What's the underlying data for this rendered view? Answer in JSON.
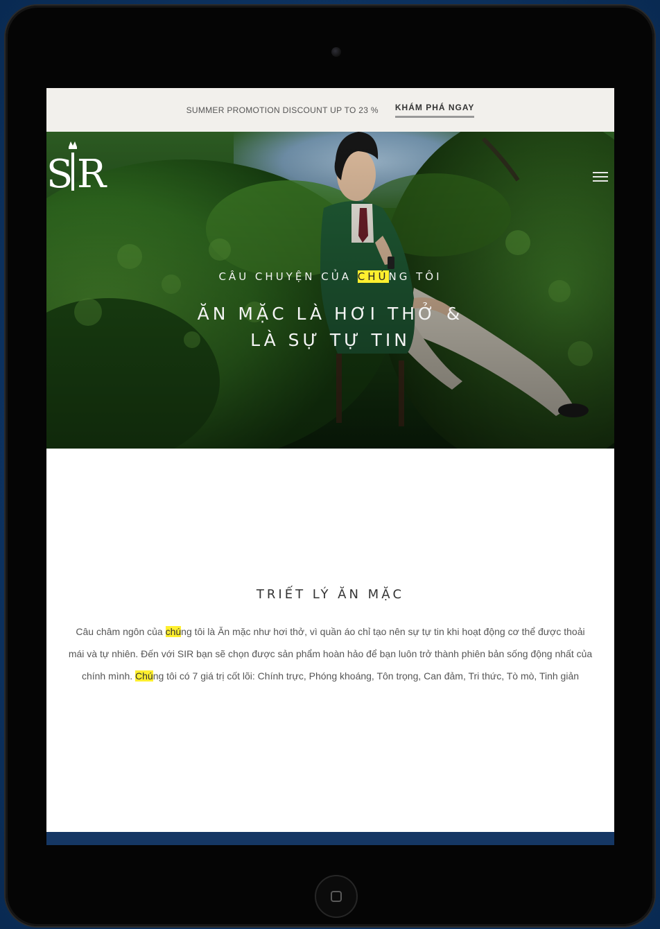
{
  "promo": {
    "text": "SUMMER PROMOTION DISCOUNT UP TO 23 %",
    "link": "KHÁM PHÁ NGAY"
  },
  "brand": {
    "logo_text": "SIR"
  },
  "hero": {
    "kicker_pre": "CÂU CHUYỆN CỦA ",
    "kicker_highlight": "CHÚ",
    "kicker_post": "NG TÔI",
    "title_line1": "ĂN MẶC LÀ HƠI THỞ &",
    "title_line2": "LÀ SỰ TỰ TIN"
  },
  "philosophy": {
    "title": "TRIẾT LÝ ĂN MẶC",
    "body_part1": "Câu châm ngôn của ",
    "body_hl1": "chú",
    "body_part2": "ng tôi là Ăn mặc như hơi thở, vì quần áo chỉ tạo nên sự tự tin khi hoạt động cơ thể được thoải mái và tự nhiên. Đến với SIR bạn sẽ chọn được sản phẩm hoàn hảo để bạn luôn trở thành phiên bản sống động nhất của chính mình. ",
    "body_hl2": "Chú",
    "body_part3": "ng tôi có 7 giá trị cốt lõi: Chính trực, Phóng khoáng, Tôn trọng, Can đảm, Tri thức, Tò mò, Tinh giản"
  },
  "colors": {
    "highlight": "#ffef2f",
    "footer_band": "#153764",
    "promo_bg": "#f2f0ec"
  },
  "icons": {
    "menu": "hamburger-menu-icon",
    "home": "home-button-icon",
    "camera": "front-camera"
  }
}
